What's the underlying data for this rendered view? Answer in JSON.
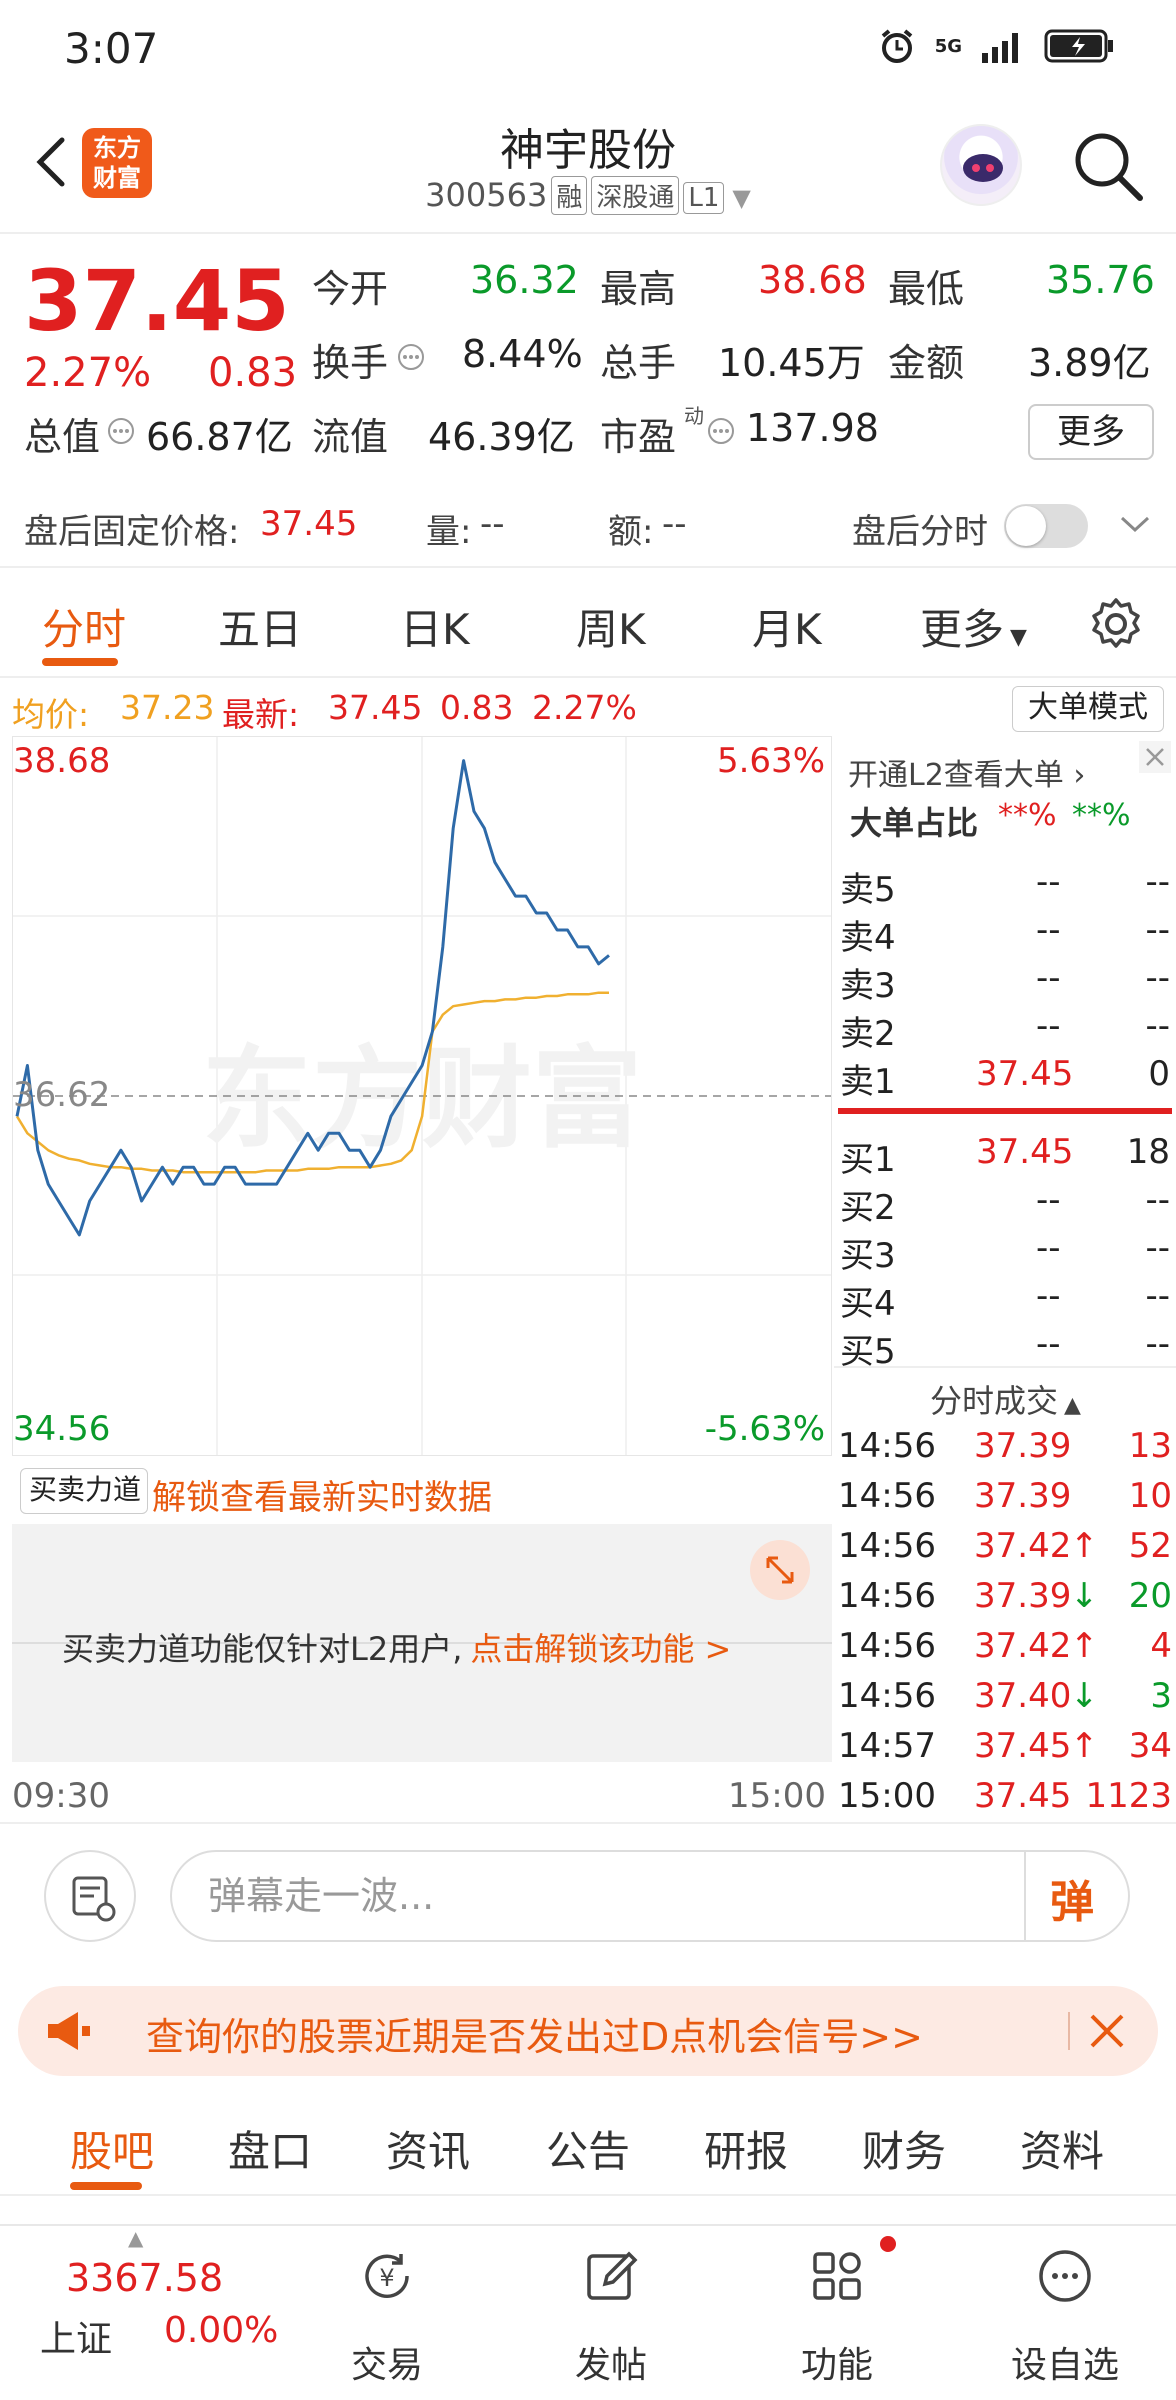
{
  "status_bar": {
    "time": "3:07",
    "network": "5G"
  },
  "header": {
    "logo_line1": "东方",
    "logo_line2": "财富",
    "title": "神宇股份",
    "code": "300563",
    "tags": [
      "融",
      "深股通",
      "L1"
    ]
  },
  "quote": {
    "price": "37.45",
    "change_pct": "2.27%",
    "change": "0.83",
    "fields": [
      {
        "label": "今开",
        "value": "36.32",
        "color": "#0a9a2a"
      },
      {
        "label": "最高",
        "value": "38.68",
        "color": "#e02020"
      },
      {
        "label": "最低",
        "value": "35.76",
        "color": "#0a9a2a"
      },
      {
        "label": "换手",
        "value": "8.44%",
        "color": "#222222"
      },
      {
        "label": "总手",
        "value": "10.45万",
        "color": "#222222"
      },
      {
        "label": "金额",
        "value": "3.89亿",
        "color": "#222222"
      },
      {
        "label": "总值",
        "value": "66.87亿",
        "color": "#222222"
      },
      {
        "label": "流值",
        "value": "46.39亿",
        "color": "#222222"
      },
      {
        "label": "市盈",
        "value": "137.98",
        "color": "#222222"
      }
    ],
    "pe_super": "动",
    "more_label": "更多"
  },
  "after_hours": {
    "price_label": "盘后固定价格:",
    "price": "37.45",
    "volume_label": "量:",
    "volume": "--",
    "amount_label": "额:",
    "amount": "--",
    "toggle_label": "盘后分时"
  },
  "tabs": [
    {
      "label": "分时"
    },
    {
      "label": "五日"
    },
    {
      "label": "日K"
    },
    {
      "label": "周K"
    },
    {
      "label": "月K"
    },
    {
      "label": "更多"
    }
  ],
  "chart_header": {
    "avg_label": "均价:",
    "avg": "37.23",
    "last_label": "最新:",
    "last": "37.45",
    "change": "0.83",
    "change_pct": "2.27%",
    "big_order_mode": "大单模式"
  },
  "chart_data": {
    "type": "line",
    "ylim": [
      34.56,
      38.68
    ],
    "y_ticks_left": [
      "38.68",
      "36.62",
      "34.56"
    ],
    "y_ticks_right": [
      "5.63%",
      "-5.63%"
    ],
    "prev_close": 36.62,
    "x_labels": [
      "09:30",
      "15:00"
    ],
    "watermark": "东方财富",
    "series": [
      {
        "name": "最新",
        "color": "#2e6aa8",
        "values": [
          36.5,
          36.8,
          36.3,
          36.1,
          36.0,
          35.9,
          35.8,
          36.0,
          36.1,
          36.2,
          36.3,
          36.2,
          36.0,
          36.1,
          36.2,
          36.1,
          36.2,
          36.2,
          36.1,
          36.1,
          36.2,
          36.2,
          36.1,
          36.1,
          36.1,
          36.1,
          36.2,
          36.3,
          36.4,
          36.3,
          36.4,
          36.4,
          36.3,
          36.3,
          36.2,
          36.3,
          36.5,
          36.6,
          36.7,
          36.8,
          37.0,
          37.5,
          38.2,
          38.6,
          38.3,
          38.2,
          38.0,
          37.9,
          37.8,
          37.8,
          37.7,
          37.7,
          37.6,
          37.6,
          37.5,
          37.5,
          37.4,
          37.45
        ]
      },
      {
        "name": "均价",
        "color": "#f0b030",
        "values": [
          36.5,
          36.4,
          36.35,
          36.3,
          36.27,
          36.25,
          36.24,
          36.22,
          36.21,
          36.2,
          36.2,
          36.19,
          36.19,
          36.18,
          36.18,
          36.18,
          36.17,
          36.17,
          36.17,
          36.17,
          36.17,
          36.17,
          36.17,
          36.17,
          36.18,
          36.18,
          36.18,
          36.18,
          36.19,
          36.19,
          36.19,
          36.2,
          36.2,
          36.2,
          36.2,
          36.21,
          36.22,
          36.24,
          36.3,
          36.5,
          37.0,
          37.1,
          37.15,
          37.16,
          37.17,
          37.18,
          37.18,
          37.19,
          37.19,
          37.2,
          37.2,
          37.21,
          37.21,
          37.22,
          37.22,
          37.22,
          37.23,
          37.23
        ]
      }
    ]
  },
  "depth": {
    "unlock_l2": "开通L2查看大单",
    "ratio_label": "大单占比",
    "ratio_buy": "**%",
    "ratio_sell": "**%",
    "asks": [
      {
        "label": "卖5",
        "price": "--",
        "vol": "--"
      },
      {
        "label": "卖4",
        "price": "--",
        "vol": "--"
      },
      {
        "label": "卖3",
        "price": "--",
        "vol": "--"
      },
      {
        "label": "卖2",
        "price": "--",
        "vol": "--"
      },
      {
        "label": "卖1",
        "price": "37.45",
        "vol": "0"
      }
    ],
    "bids": [
      {
        "label": "买1",
        "price": "37.45",
        "vol": "18"
      },
      {
        "label": "买2",
        "price": "--",
        "vol": "--"
      },
      {
        "label": "买3",
        "price": "--",
        "vol": "--"
      },
      {
        "label": "买4",
        "price": "--",
        "vol": "--"
      },
      {
        "label": "买5",
        "price": "--",
        "vol": "--"
      }
    ],
    "trades_title": "分时成交",
    "trades": [
      {
        "time": "14:56",
        "price": "37.39",
        "dir": "",
        "vol": "13",
        "vol_color": "#e02020"
      },
      {
        "time": "14:56",
        "price": "37.39",
        "dir": "",
        "vol": "10",
        "vol_color": "#e02020"
      },
      {
        "time": "14:56",
        "price": "37.42",
        "dir": "↑",
        "vol": "52",
        "vol_color": "#e02020"
      },
      {
        "time": "14:56",
        "price": "37.39",
        "dir": "↓",
        "vol": "20",
        "vol_color": "#0a9a2a"
      },
      {
        "time": "14:56",
        "price": "37.42",
        "dir": "↑",
        "vol": "4",
        "vol_color": "#e02020"
      },
      {
        "time": "14:56",
        "price": "37.40",
        "dir": "↓",
        "vol": "3",
        "vol_color": "#0a9a2a"
      },
      {
        "time": "14:57",
        "price": "37.45",
        "dir": "↑",
        "vol": "34",
        "vol_color": "#e02020"
      },
      {
        "time": "15:00",
        "price": "37.45",
        "dir": "",
        "vol": "1123",
        "vol_color": "#e02020"
      }
    ]
  },
  "force": {
    "select_label": "买卖力道",
    "unlock_text": "解锁查看最新实时数据",
    "panel_text": "买卖力道功能仅针对L2用户,",
    "panel_link": "点击解锁该功能 >"
  },
  "comment": {
    "placeholder": "弹幕走一波...",
    "danmu": "弹"
  },
  "banner": {
    "text": "查询你的股票近期是否发出过D点机会信号>>"
  },
  "bottom_tabs": [
    {
      "label": "股吧"
    },
    {
      "label": "盘口"
    },
    {
      "label": "资讯"
    },
    {
      "label": "公告"
    },
    {
      "label": "研报"
    },
    {
      "label": "财务"
    },
    {
      "label": "资料"
    }
  ],
  "nav": {
    "index_value": "3367.58",
    "index_name": "上证",
    "index_change": "0.00%",
    "items": [
      {
        "label": "交易",
        "icon": "trade-icon"
      },
      {
        "label": "发帖",
        "icon": "post-icon"
      },
      {
        "label": "功能",
        "icon": "function-icon"
      },
      {
        "label": "设自选",
        "icon": "watchlist-icon"
      }
    ]
  }
}
